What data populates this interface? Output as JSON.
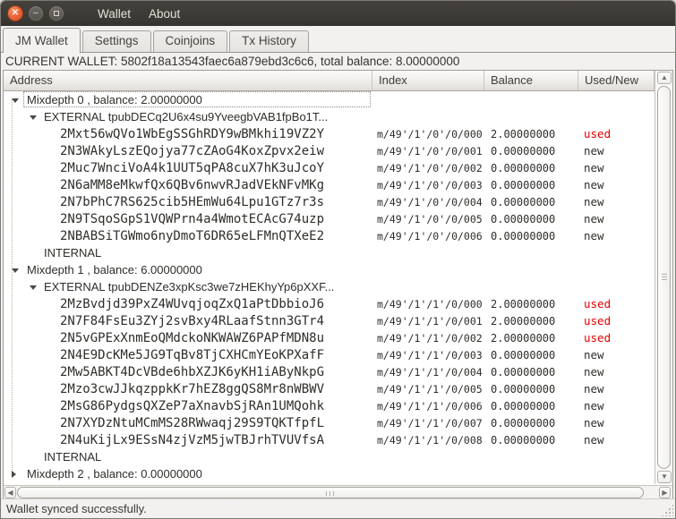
{
  "titlebar": {
    "menu": [
      "Wallet",
      "About"
    ]
  },
  "tabs": [
    {
      "label": "JM Wallet",
      "active": true
    },
    {
      "label": "Settings",
      "active": false
    },
    {
      "label": "Coinjoins",
      "active": false
    },
    {
      "label": "Tx History",
      "active": false
    }
  ],
  "banner": {
    "text": "CURRENT WALLET: 5802f18a13543faec6a879ebd3c6c6, total balance: 8.00000000"
  },
  "tree": {
    "columns": [
      "Address",
      "Index",
      "Balance",
      "Used/New"
    ],
    "rows": [
      {
        "type": "mixdepth",
        "expanded": true,
        "focused": true,
        "label": "Mixdepth 0 , balance: 2.00000000"
      },
      {
        "type": "branch",
        "expanded": true,
        "label": "EXTERNAL tpubDECq2U6x4su9YveegbVAB1fpBo1T..."
      },
      {
        "type": "address",
        "address": "2Mxt56wQVo1WbEgSSGhRDY9wBMkhi19VZ2Y",
        "index": "m/49'/1'/0'/0/000",
        "balance": "2.00000000",
        "status": "used"
      },
      {
        "type": "address",
        "address": "2N3WAkyLszEQojya77cZAoG4KoxZpvx2eiw",
        "index": "m/49'/1'/0'/0/001",
        "balance": "0.00000000",
        "status": "new"
      },
      {
        "type": "address",
        "address": "2Muc7WnciVoA4k1UUT5qPA8cuX7hK3uJcoY",
        "index": "m/49'/1'/0'/0/002",
        "balance": "0.00000000",
        "status": "new"
      },
      {
        "type": "address",
        "address": "2N6aMM8eMkwfQx6QBv6nwvRJadVEkNFvMKg",
        "index": "m/49'/1'/0'/0/003",
        "balance": "0.00000000",
        "status": "new"
      },
      {
        "type": "address",
        "address": "2N7bPhC7RS625cib5HEmWu64Lpu1GTz7r3s",
        "index": "m/49'/1'/0'/0/004",
        "balance": "0.00000000",
        "status": "new"
      },
      {
        "type": "address",
        "address": "2N9TSqoSGpS1VQWPrn4a4WmotECAcG74uzp",
        "index": "m/49'/1'/0'/0/005",
        "balance": "0.00000000",
        "status": "new"
      },
      {
        "type": "address",
        "address": "2NBABSiTGWmo6nyDmoT6DR65eLFMnQTXeE2",
        "index": "m/49'/1'/0'/0/006",
        "balance": "0.00000000",
        "status": "new"
      },
      {
        "type": "branch",
        "expanded": null,
        "label": "INTERNAL"
      },
      {
        "type": "mixdepth",
        "expanded": true,
        "label": "Mixdepth 1 , balance: 6.00000000"
      },
      {
        "type": "branch",
        "expanded": true,
        "label": "EXTERNAL tpubDENZe3xpKsc3we7zHEKhyYp6pXXF..."
      },
      {
        "type": "address",
        "address": "2MzBvdjd39PxZ4WUvqjoqZxQ1aPtDbbioJ6",
        "index": "m/49'/1'/1'/0/000",
        "balance": "2.00000000",
        "status": "used"
      },
      {
        "type": "address",
        "address": "2N7F84FsEu3ZYj2svBxy4RLaafStnn3GTr4",
        "index": "m/49'/1'/1'/0/001",
        "balance": "2.00000000",
        "status": "used"
      },
      {
        "type": "address",
        "address": "2N5vGPExXnmEoQMdckoNKWAWZ6PAPfMDN8u",
        "index": "m/49'/1'/1'/0/002",
        "balance": "2.00000000",
        "status": "used"
      },
      {
        "type": "address",
        "address": "2N4E9DcKMe5JG9TqBv8TjCXHCmYEoKPXafF",
        "index": "m/49'/1'/1'/0/003",
        "balance": "0.00000000",
        "status": "new"
      },
      {
        "type": "address",
        "address": "2Mw5ABKT4DcVBde6hbXZJK6yKH1iAByNkpG",
        "index": "m/49'/1'/1'/0/004",
        "balance": "0.00000000",
        "status": "new"
      },
      {
        "type": "address",
        "address": "2Mzo3cwJJkqzppkKr7hEZ8ggQS8Mr8nWBWV",
        "index": "m/49'/1'/1'/0/005",
        "balance": "0.00000000",
        "status": "new"
      },
      {
        "type": "address",
        "address": "2MsG86PydgsQXZeP7aXnavbSjRAn1UMQohk",
        "index": "m/49'/1'/1'/0/006",
        "balance": "0.00000000",
        "status": "new"
      },
      {
        "type": "address",
        "address": "2N7XYDzNtuMCmMS28RWwaqj29S9TQKTfpfL",
        "index": "m/49'/1'/1'/0/007",
        "balance": "0.00000000",
        "status": "new"
      },
      {
        "type": "address",
        "address": "2N4uKijLx9ESsN4zjVzM5jwTBJrhTVUVfsA",
        "index": "m/49'/1'/1'/0/008",
        "balance": "0.00000000",
        "status": "new"
      },
      {
        "type": "branch",
        "expanded": null,
        "label": "INTERNAL"
      },
      {
        "type": "mixdepth",
        "expanded": false,
        "label": "Mixdepth 2 , balance: 0.00000000"
      }
    ]
  },
  "statusbar": {
    "text": "Wallet synced successfully."
  },
  "colors": {
    "used_status": "#e80000",
    "close_button": "#e75f33",
    "titlebar": "#3a3833"
  }
}
